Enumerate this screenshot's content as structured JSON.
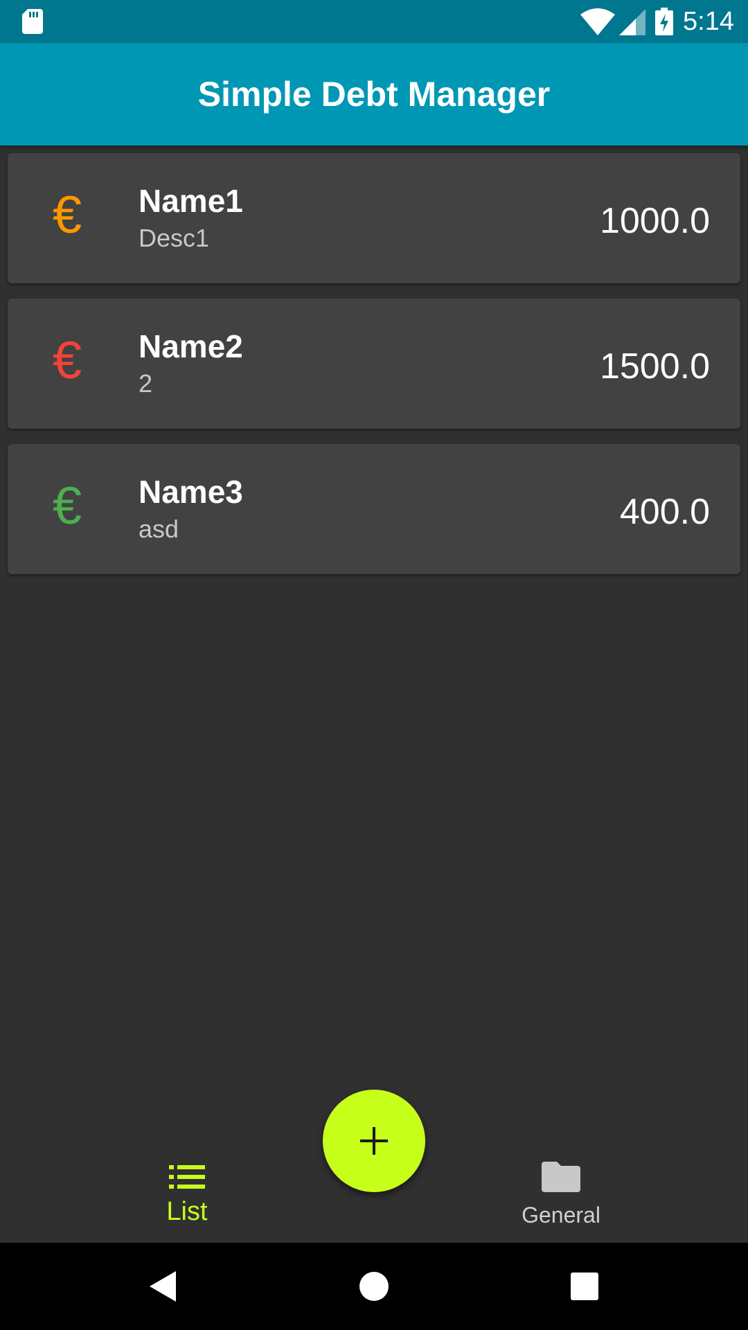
{
  "status_bar": {
    "time": "5:14",
    "icons": [
      "sd-card-icon",
      "wifi-icon",
      "cell-signal-icon",
      "battery-charging-icon"
    ]
  },
  "app_bar": {
    "title": "Simple Debt Manager"
  },
  "debts": [
    {
      "name": "Name1",
      "description": "Desc1",
      "amount": "1000.0",
      "icon": "euro-icon",
      "color": "#ff9800"
    },
    {
      "name": "Name2",
      "description": "2",
      "amount": "1500.0",
      "icon": "euro-icon",
      "color": "#f44336"
    },
    {
      "name": "Name3",
      "description": "asd",
      "amount": "400.0",
      "icon": "euro-icon",
      "color": "#4caf50"
    }
  ],
  "fab": {
    "icon": "plus-icon",
    "color": "#c6ff1a"
  },
  "bottom_nav": {
    "items": [
      {
        "label": "List",
        "icon": "list-icon",
        "active": true
      },
      {
        "label": "General",
        "icon": "folder-icon",
        "active": false
      }
    ],
    "accent": "#c6ff1a"
  },
  "system_nav": {
    "icons": [
      "back-icon",
      "home-icon",
      "recents-icon"
    ]
  },
  "colors": {
    "primary": "#0097b5",
    "primary_dark": "#00778f",
    "background": "#303030",
    "card": "#424242"
  }
}
